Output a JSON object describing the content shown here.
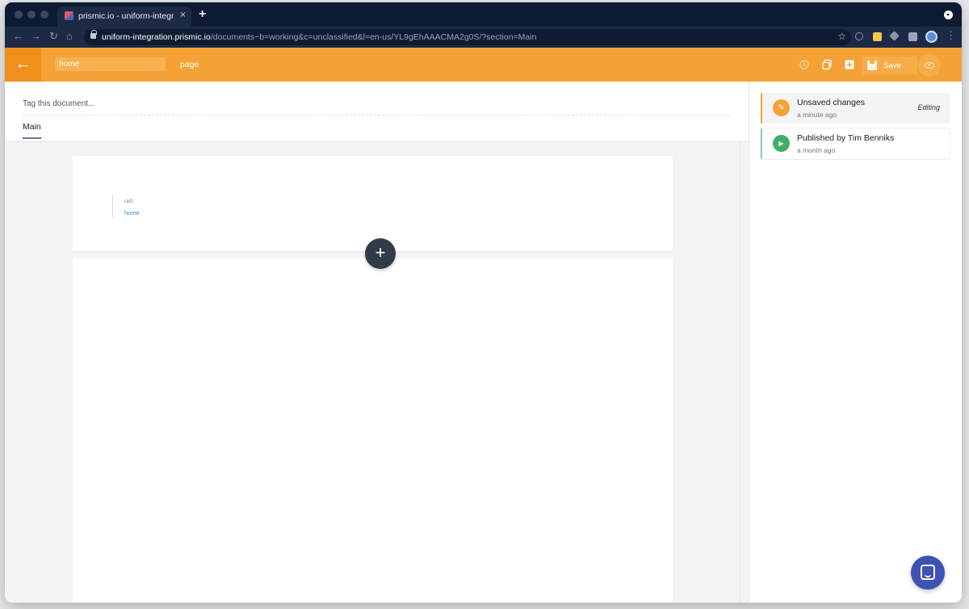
{
  "browser": {
    "tab_title": "prismic.io - uniform-integration",
    "tab_close": "×",
    "new_tab": "+",
    "url_host": "uniform-integration.prismic.io",
    "url_path": "/documents~b=working&c=unclassified&l=en-us/YL9gEhAAACMA2g0S/?section=Main",
    "nav": {
      "back": "←",
      "forward": "→",
      "reload": "↻",
      "home": "⌂",
      "star": "☆"
    }
  },
  "header": {
    "back_glyph": "←",
    "uid_value": "home",
    "custom_type": "page",
    "save_label": "Save",
    "icons": [
      "history-icon",
      "duplicate-icon",
      "add-icon",
      "save-icon",
      "preview-eye-icon"
    ]
  },
  "editor": {
    "tag_placeholder": "Tag this document...",
    "tabs": [
      {
        "label": "Main"
      }
    ],
    "uid_field": {
      "label": "uid",
      "value": "home"
    },
    "add_slice_glyph": "+"
  },
  "history": [
    {
      "title": "Unsaved changes",
      "time": "a minute ago",
      "status": "Editing",
      "badge": "✎",
      "color": "#f4a236"
    },
    {
      "title": "Published by Tim Benniks",
      "time": "a month ago",
      "badge": "▶",
      "color": "#3fae6b"
    }
  ],
  "colors": {
    "brand": "#f4a236",
    "accent": "#3f51b5",
    "published": "#3fae6b"
  }
}
